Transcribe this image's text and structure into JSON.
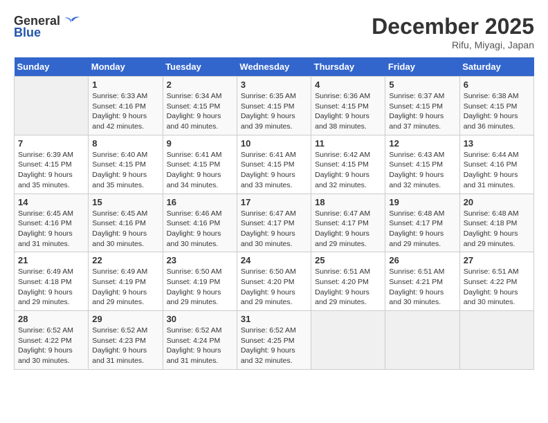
{
  "header": {
    "logo_general": "General",
    "logo_blue": "Blue",
    "month_title": "December 2025",
    "location": "Rifu, Miyagi, Japan"
  },
  "days_of_week": [
    "Sunday",
    "Monday",
    "Tuesday",
    "Wednesday",
    "Thursday",
    "Friday",
    "Saturday"
  ],
  "weeks": [
    [
      {
        "day": "",
        "info": ""
      },
      {
        "day": "1",
        "info": "Sunrise: 6:33 AM\nSunset: 4:16 PM\nDaylight: 9 hours\nand 42 minutes."
      },
      {
        "day": "2",
        "info": "Sunrise: 6:34 AM\nSunset: 4:15 PM\nDaylight: 9 hours\nand 40 minutes."
      },
      {
        "day": "3",
        "info": "Sunrise: 6:35 AM\nSunset: 4:15 PM\nDaylight: 9 hours\nand 39 minutes."
      },
      {
        "day": "4",
        "info": "Sunrise: 6:36 AM\nSunset: 4:15 PM\nDaylight: 9 hours\nand 38 minutes."
      },
      {
        "day": "5",
        "info": "Sunrise: 6:37 AM\nSunset: 4:15 PM\nDaylight: 9 hours\nand 37 minutes."
      },
      {
        "day": "6",
        "info": "Sunrise: 6:38 AM\nSunset: 4:15 PM\nDaylight: 9 hours\nand 36 minutes."
      }
    ],
    [
      {
        "day": "7",
        "info": "Sunrise: 6:39 AM\nSunset: 4:15 PM\nDaylight: 9 hours\nand 35 minutes."
      },
      {
        "day": "8",
        "info": "Sunrise: 6:40 AM\nSunset: 4:15 PM\nDaylight: 9 hours\nand 35 minutes."
      },
      {
        "day": "9",
        "info": "Sunrise: 6:41 AM\nSunset: 4:15 PM\nDaylight: 9 hours\nand 34 minutes."
      },
      {
        "day": "10",
        "info": "Sunrise: 6:41 AM\nSunset: 4:15 PM\nDaylight: 9 hours\nand 33 minutes."
      },
      {
        "day": "11",
        "info": "Sunrise: 6:42 AM\nSunset: 4:15 PM\nDaylight: 9 hours\nand 32 minutes."
      },
      {
        "day": "12",
        "info": "Sunrise: 6:43 AM\nSunset: 4:15 PM\nDaylight: 9 hours\nand 32 minutes."
      },
      {
        "day": "13",
        "info": "Sunrise: 6:44 AM\nSunset: 4:16 PM\nDaylight: 9 hours\nand 31 minutes."
      }
    ],
    [
      {
        "day": "14",
        "info": "Sunrise: 6:45 AM\nSunset: 4:16 PM\nDaylight: 9 hours\nand 31 minutes."
      },
      {
        "day": "15",
        "info": "Sunrise: 6:45 AM\nSunset: 4:16 PM\nDaylight: 9 hours\nand 30 minutes."
      },
      {
        "day": "16",
        "info": "Sunrise: 6:46 AM\nSunset: 4:16 PM\nDaylight: 9 hours\nand 30 minutes."
      },
      {
        "day": "17",
        "info": "Sunrise: 6:47 AM\nSunset: 4:17 PM\nDaylight: 9 hours\nand 30 minutes."
      },
      {
        "day": "18",
        "info": "Sunrise: 6:47 AM\nSunset: 4:17 PM\nDaylight: 9 hours\nand 29 minutes."
      },
      {
        "day": "19",
        "info": "Sunrise: 6:48 AM\nSunset: 4:17 PM\nDaylight: 9 hours\nand 29 minutes."
      },
      {
        "day": "20",
        "info": "Sunrise: 6:48 AM\nSunset: 4:18 PM\nDaylight: 9 hours\nand 29 minutes."
      }
    ],
    [
      {
        "day": "21",
        "info": "Sunrise: 6:49 AM\nSunset: 4:18 PM\nDaylight: 9 hours\nand 29 minutes."
      },
      {
        "day": "22",
        "info": "Sunrise: 6:49 AM\nSunset: 4:19 PM\nDaylight: 9 hours\nand 29 minutes."
      },
      {
        "day": "23",
        "info": "Sunrise: 6:50 AM\nSunset: 4:19 PM\nDaylight: 9 hours\nand 29 minutes."
      },
      {
        "day": "24",
        "info": "Sunrise: 6:50 AM\nSunset: 4:20 PM\nDaylight: 9 hours\nand 29 minutes."
      },
      {
        "day": "25",
        "info": "Sunrise: 6:51 AM\nSunset: 4:20 PM\nDaylight: 9 hours\nand 29 minutes."
      },
      {
        "day": "26",
        "info": "Sunrise: 6:51 AM\nSunset: 4:21 PM\nDaylight: 9 hours\nand 30 minutes."
      },
      {
        "day": "27",
        "info": "Sunrise: 6:51 AM\nSunset: 4:22 PM\nDaylight: 9 hours\nand 30 minutes."
      }
    ],
    [
      {
        "day": "28",
        "info": "Sunrise: 6:52 AM\nSunset: 4:22 PM\nDaylight: 9 hours\nand 30 minutes."
      },
      {
        "day": "29",
        "info": "Sunrise: 6:52 AM\nSunset: 4:23 PM\nDaylight: 9 hours\nand 31 minutes."
      },
      {
        "day": "30",
        "info": "Sunrise: 6:52 AM\nSunset: 4:24 PM\nDaylight: 9 hours\nand 31 minutes."
      },
      {
        "day": "31",
        "info": "Sunrise: 6:52 AM\nSunset: 4:25 PM\nDaylight: 9 hours\nand 32 minutes."
      },
      {
        "day": "",
        "info": ""
      },
      {
        "day": "",
        "info": ""
      },
      {
        "day": "",
        "info": ""
      }
    ]
  ]
}
